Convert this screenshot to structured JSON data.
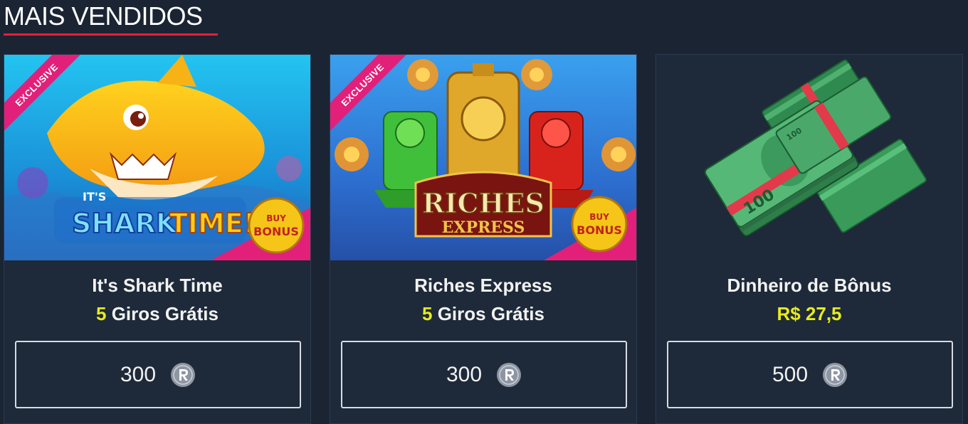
{
  "section": {
    "title": "MAIS VENDIDOS"
  },
  "cards": [
    {
      "name": "It's Shark Time",
      "reward_amount": "5",
      "reward_label": "Giros Grátis",
      "price": "300",
      "badge": "EXCLUSIVE",
      "art_title": "It's SHARK TIME!",
      "art_badge": "BUY BONUS"
    },
    {
      "name": "Riches Express",
      "reward_amount": "5",
      "reward_label": "Giros Grátis",
      "price": "300",
      "badge": "EXCLUSIVE",
      "art_title": "RICHES EXPRESS",
      "art_badge": "BUY BONUS"
    },
    {
      "name": "Dinheiro de Bônus",
      "reward_amount": "R$ 27,5",
      "reward_label": "",
      "price": "500",
      "art_note": "100"
    }
  ],
  "coin_icon": "points-coin-icon",
  "colors": {
    "background": "#1b2433",
    "card": "#1e293a",
    "accent_red": "#e3203d",
    "accent_yellow": "#e8ec1c",
    "exclusive_pink": "#e2207a"
  }
}
